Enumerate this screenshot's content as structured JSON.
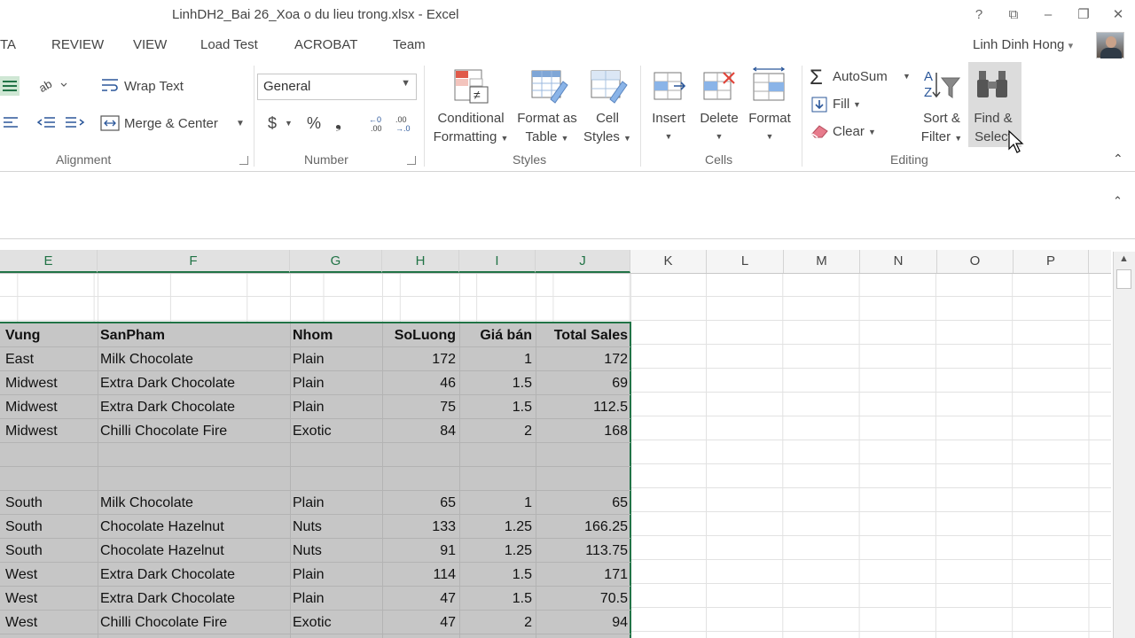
{
  "window": {
    "title": "LinhDH2_Bai 26_Xoa o du lieu trong.xlsx - Excel",
    "help": "?",
    "ribbon_display": "⧉",
    "minimize": "–",
    "restore": "❐",
    "close": "✕"
  },
  "tabs": [
    "TA",
    "REVIEW",
    "VIEW",
    "Load Test",
    "ACROBAT",
    "Team"
  ],
  "user": {
    "name": "Linh Dinh Hong",
    "caret": "▾"
  },
  "ribbon": {
    "alignment": {
      "wrap_text": "Wrap Text",
      "merge_center": "Merge & Center",
      "group": "Alignment"
    },
    "number": {
      "format": "General",
      "dollar": "$",
      "percent": "%",
      "comma": "❟",
      "group": "Number"
    },
    "styles": {
      "conditional_1": "Conditional",
      "conditional_2": "Formatting",
      "format_table_1": "Format as",
      "format_table_2": "Table",
      "cell_styles_1": "Cell",
      "cell_styles_2": "Styles",
      "group": "Styles"
    },
    "cells": {
      "insert": "Insert",
      "delete": "Delete",
      "format": "Format",
      "group": "Cells"
    },
    "editing": {
      "autosum": "AutoSum",
      "fill": "Fill",
      "clear": "Clear",
      "sort_1": "Sort &",
      "sort_2": "Filter",
      "find_1": "Find &",
      "find_2": "Select",
      "group": "Editing"
    },
    "collapse": "⌃"
  },
  "formula_bar": {
    "expand": "⌃"
  },
  "sheet": {
    "columns": [
      "E",
      "F",
      "G",
      "H",
      "I",
      "J",
      "K",
      "L",
      "M",
      "N",
      "O",
      "P"
    ],
    "header_row": [
      "Vung",
      "SanPham",
      "Nhom",
      "SoLuong",
      "Giá bán",
      "Total Sales"
    ],
    "rows": [
      [
        "East",
        "Milk Chocolate",
        "Plain",
        "172",
        "1",
        "172"
      ],
      [
        "Midwest",
        "Extra Dark Chocolate",
        "Plain",
        "46",
        "1.5",
        "69"
      ],
      [
        "Midwest",
        "Extra Dark Chocolate",
        "Plain",
        "75",
        "1.5",
        "112.5"
      ],
      [
        "Midwest",
        "Chilli Chocolate Fire",
        "Exotic",
        "84",
        "2",
        "168"
      ],
      [
        "",
        "",
        "",
        "",
        "",
        ""
      ],
      [
        "",
        "",
        "",
        "",
        "",
        ""
      ],
      [
        "South",
        "Milk Chocolate",
        "Plain",
        "65",
        "1",
        "65"
      ],
      [
        "South",
        "Chocolate Hazelnut",
        "Nuts",
        "133",
        "1.25",
        "166.25"
      ],
      [
        "South",
        "Chocolate Hazelnut",
        "Nuts",
        "91",
        "1.25",
        "113.75"
      ],
      [
        "West",
        "Extra Dark Chocolate",
        "Plain",
        "114",
        "1.5",
        "171"
      ],
      [
        "West",
        "Extra Dark Chocolate",
        "Plain",
        "47",
        "1.5",
        "70.5"
      ],
      [
        "West",
        "Chilli Chocolate Fire",
        "Exotic",
        "47",
        "2",
        "94"
      ]
    ]
  },
  "colors": {
    "accent": "#217346",
    "selection": "#c6c6c6"
  }
}
